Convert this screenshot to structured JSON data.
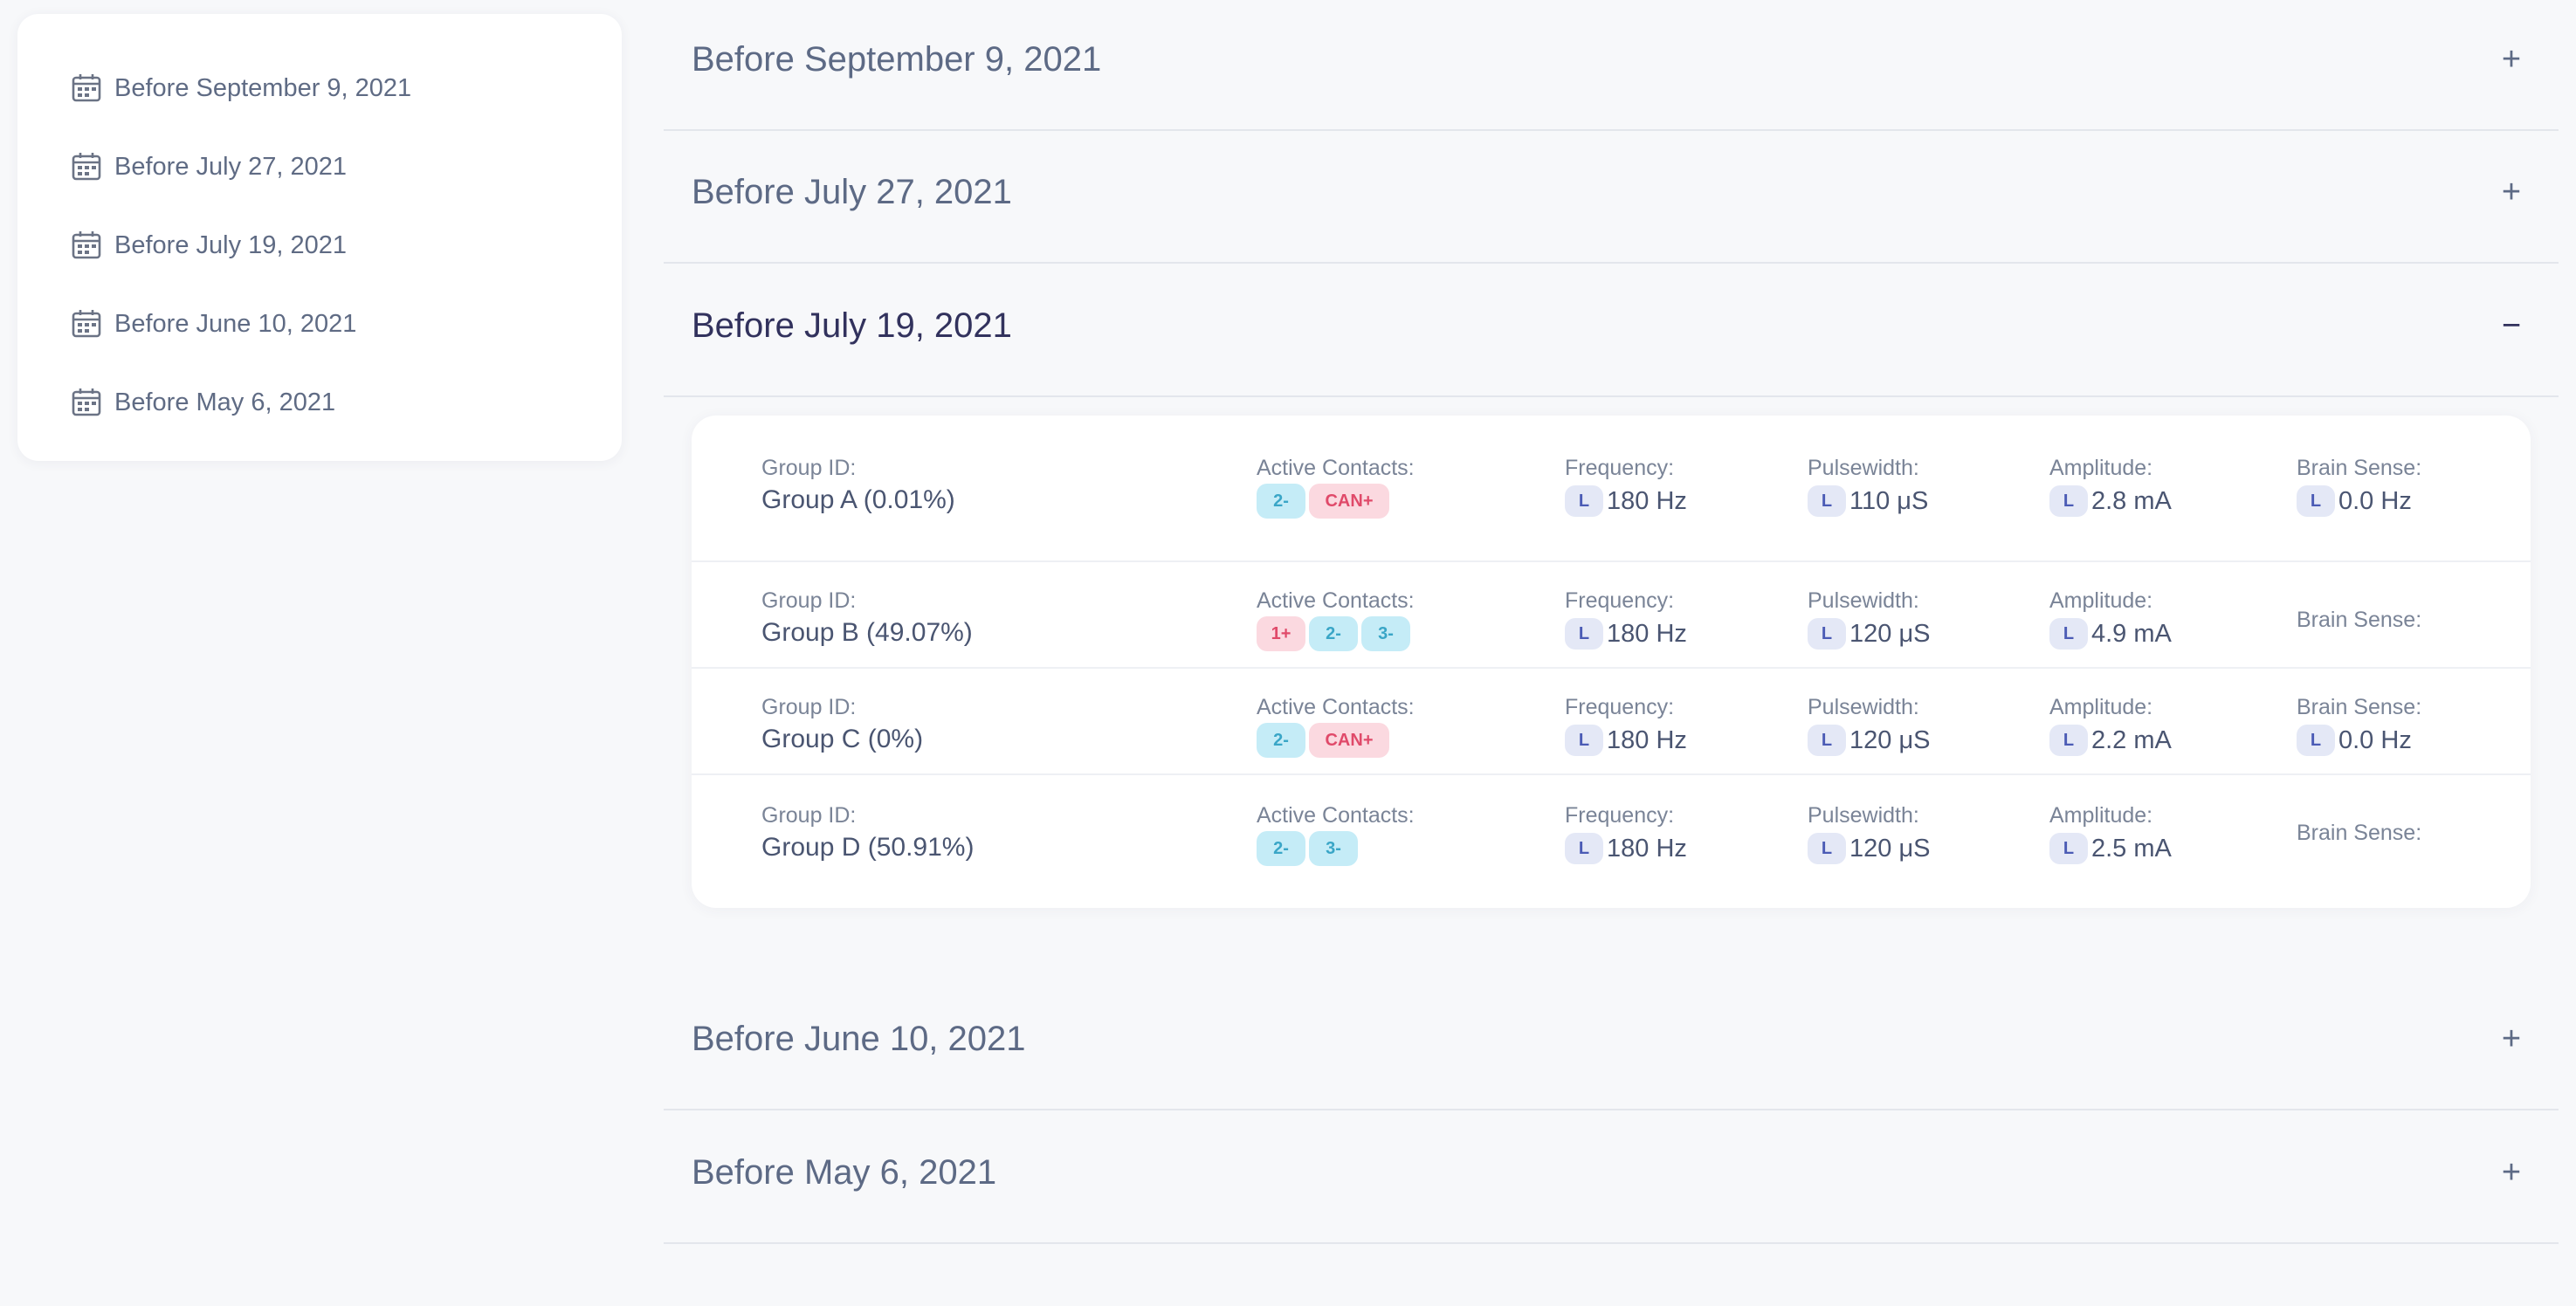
{
  "sidebar": {
    "items": [
      {
        "label": "Before September 9, 2021",
        "icon": "calendar-icon"
      },
      {
        "label": "Before July 27, 2021",
        "icon": "calendar-icon"
      },
      {
        "label": "Before July 19, 2021",
        "icon": "calendar-icon"
      },
      {
        "label": "Before June 10, 2021",
        "icon": "calendar-icon"
      },
      {
        "label": "Before May 6, 2021",
        "icon": "calendar-icon"
      }
    ]
  },
  "accordion": {
    "sections": [
      {
        "title": "Before September 9, 2021",
        "toggle": "+",
        "expanded": false
      },
      {
        "title": "Before July 27, 2021",
        "toggle": "+",
        "expanded": false
      },
      {
        "title": "Before July 19, 2021",
        "toggle": "−",
        "expanded": true
      },
      {
        "title": "Before June 10, 2021",
        "toggle": "+",
        "expanded": false
      },
      {
        "title": "Before May 6, 2021",
        "toggle": "+",
        "expanded": false
      }
    ]
  },
  "labels": {
    "group_id": "Group ID:",
    "active_contacts": "Active Contacts:",
    "frequency": "Frequency:",
    "pulsewidth": "Pulsewidth:",
    "amplitude": "Amplitude:",
    "brain_sense": "Brain Sense:",
    "side": "L"
  },
  "groups": [
    {
      "name": "Group A (0.01%)",
      "contacts": [
        {
          "label": "2-",
          "kind": "neg"
        },
        {
          "label": "CAN+",
          "kind": "can"
        }
      ],
      "frequency": "180 Hz",
      "pulsewidth": "110 μS",
      "amplitude": "2.8 mA",
      "brain_sense": "0.0 Hz"
    },
    {
      "name": "Group B (49.07%)",
      "contacts": [
        {
          "label": "1+",
          "kind": "pos"
        },
        {
          "label": "2-",
          "kind": "neg"
        },
        {
          "label": "3-",
          "kind": "neg"
        }
      ],
      "frequency": "180 Hz",
      "pulsewidth": "120 μS",
      "amplitude": "4.9 mA",
      "brain_sense": null
    },
    {
      "name": "Group C (0%)",
      "contacts": [
        {
          "label": "2-",
          "kind": "neg"
        },
        {
          "label": "CAN+",
          "kind": "can"
        }
      ],
      "frequency": "180 Hz",
      "pulsewidth": "120 μS",
      "amplitude": "2.2 mA",
      "brain_sense": "0.0 Hz"
    },
    {
      "name": "Group D (50.91%)",
      "contacts": [
        {
          "label": "2-",
          "kind": "neg"
        },
        {
          "label": "3-",
          "kind": "neg"
        }
      ],
      "frequency": "180 Hz",
      "pulsewidth": "120 μS",
      "amplitude": "2.5 mA",
      "brain_sense": null
    }
  ],
  "colors": {
    "background": "#f7f8fa",
    "card": "#ffffff",
    "text": "#525f7f",
    "heading_active": "#32325d",
    "contact_negative_bg": "#c5ecf7",
    "contact_negative_text": "#3aa6c7",
    "contact_positive_bg": "#fbd9e0",
    "contact_positive_text": "#e04a6a",
    "side_badge_bg": "#e4e8f6",
    "side_badge_text": "#4b5bb5"
  }
}
